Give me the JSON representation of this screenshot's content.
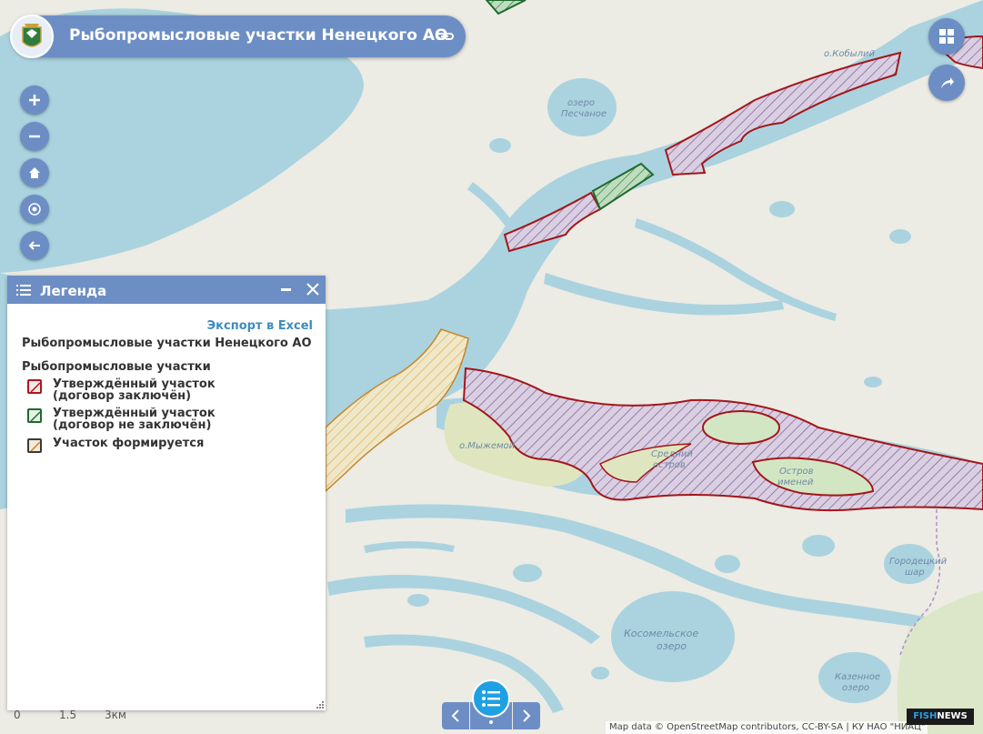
{
  "header": {
    "title": "Рыбопромысловые участки Ненецкого АО"
  },
  "map_controls": [
    {
      "name": "zoom-in",
      "icon": "plus-icon"
    },
    {
      "name": "zoom-out",
      "icon": "minus-icon"
    },
    {
      "name": "home",
      "icon": "home-icon"
    },
    {
      "name": "locate",
      "icon": "target-icon"
    },
    {
      "name": "back",
      "icon": "arrow-left-icon"
    }
  ],
  "right_controls": [
    {
      "name": "basemap-gallery",
      "icon": "grid-icon"
    },
    {
      "name": "share",
      "icon": "share-icon"
    }
  ],
  "map_labels": {
    "kobyliy": "о.Кобылий",
    "ozero": "озеро",
    "peschanoe": "Песчаное",
    "myzhemoy": "о.Мыжемой",
    "sredniy1": "Средний",
    "sredniy2": "остров",
    "ostrov1": "Остров",
    "ostrov2": "именей",
    "gorodetskiy1": "Городецкий",
    "gorodetskiy2": "шар",
    "kosomelskoe1": "Косомельское",
    "kosomelskoe2": "озеро",
    "kazennoe1": "Казенное",
    "kazennoe2": "озеро"
  },
  "legend": {
    "title": "Легенда",
    "export_label": "Экспорт в Excel",
    "layer_title": "Рыбопромысловые участки Ненецкого АО",
    "group_title": "Рыбопромысловые участки",
    "items": [
      {
        "label": "Утверждённый участок (договор заключён)",
        "color": "#b0161b"
      },
      {
        "label": "Утверждённый участок (договор не заключён)",
        "color": "#1e6b2e"
      },
      {
        "label": "Участок формируется",
        "color": "#c6862a"
      }
    ]
  },
  "scale": {
    "t0": "0",
    "t1": "1.5",
    "t2": "3км"
  },
  "attribution": "Map data © OpenStreetMap contributors, CC-BY-SA | КУ НАО \"НИАЦ\"",
  "watermark": {
    "part1": "FISH",
    "part2": "NEWS"
  },
  "colors": {
    "accent": "#6d8ec4",
    "water": "#aad3df",
    "land": "#ecebe4",
    "primary_button": "#1fa0e3"
  }
}
